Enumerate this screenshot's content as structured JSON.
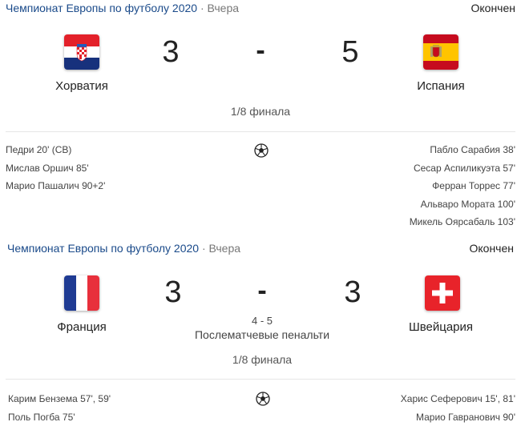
{
  "matches": [
    {
      "league": "Чемпионат Европы по футболу 2020",
      "separator": "·",
      "when": "Вчера",
      "status": "Окончен",
      "home": {
        "name": "Хорватия",
        "score": "3",
        "flag_icon": "croatia-flag-icon"
      },
      "away": {
        "name": "Испания",
        "score": "5",
        "flag_icon": "spain-flag-icon"
      },
      "dash": "-",
      "round": "1/8 финала",
      "home_scorers": [
        "Педри 20' (СВ)",
        "Мислав Оршич 85'",
        "Марио Пашалич 90+2'"
      ],
      "away_scorers": [
        "Пабло Сарабия 38'",
        "Сесар Аспиликуэта 57'",
        "Ферран Торрес 77'",
        "Альваро Мората 100'",
        "Микель Ояpсабаль 103'"
      ]
    },
    {
      "league": "Чемпионат Европы по футболу 2020",
      "separator": "·",
      "when": "Вчера",
      "status": "Окончен",
      "home": {
        "name": "Франция",
        "score": "3",
        "flag_icon": "france-flag-icon"
      },
      "away": {
        "name": "Швейцария",
        "score": "3",
        "flag_icon": "switzerland-flag-icon"
      },
      "dash": "-",
      "penalty_score": "4 - 5",
      "penalty_label": "Послематчевые пенальти",
      "round": "1/8 финала",
      "home_scorers": [
        "Карим Бензема 57', 59'",
        "Поль Погба 75'"
      ],
      "away_scorers": [
        "Харис Сеферович 15', 81'",
        "Марио Гавранович 90'"
      ]
    }
  ],
  "icons": {
    "goal": "soccer-ball-icon"
  },
  "colors": {
    "league_link": "#1a4a8a",
    "divider": "#e6e6e6"
  }
}
